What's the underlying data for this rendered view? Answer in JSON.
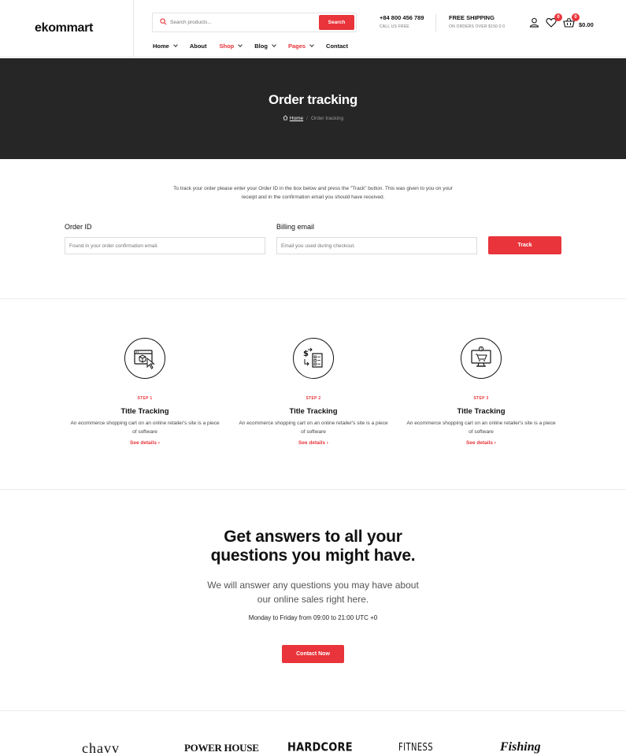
{
  "header": {
    "logo": "ekommart",
    "search": {
      "placeholder": "Search products...",
      "button": "Search"
    },
    "phone": "+84 800 456 789",
    "phone_sub": "CALL US FREE",
    "shipping": "FREE SHIPPING",
    "shipping_sub": "ON ORDERS OVER $150.0 0",
    "wishlist_count": "0",
    "cart_count": "0",
    "cart_total": "$0.00",
    "nav": [
      {
        "label": "Home"
      },
      {
        "label": "About"
      },
      {
        "label": "Shop"
      },
      {
        "label": "Blog"
      },
      {
        "label": "Pages"
      },
      {
        "label": "Contact"
      }
    ]
  },
  "banner": {
    "title": "Order tracking",
    "breadcrumb": {
      "home": "Home",
      "current": "Order tracking"
    }
  },
  "tracking": {
    "intro": "To track your order please enter your Order ID in the box below and press the \"Track\" button. This was given to you on your receipt and in the confirmation email you should have received.",
    "order_label": "Order ID",
    "order_placeholder": "Found in your order confirmation email.",
    "email_label": "Billing email",
    "email_placeholder": "Email you used during checkout.",
    "button": "Track"
  },
  "steps": [
    {
      "icon": "browser-box-cursor-icon",
      "num": "STEP 1",
      "title": "Title Tracking",
      "desc": "An ecommerce shopping cart on an online retailer's site is a piece of software",
      "link": "See details ›"
    },
    {
      "icon": "dollar-exchange-checklist-icon",
      "num": "STEP 2",
      "title": "Title Tracking",
      "desc": "An ecommerce shopping cart on an online retailer's site is a piece of software",
      "link": "See details ›"
    },
    {
      "icon": "monitor-cart-icon",
      "num": "STEP 3",
      "title": "Title Tracking",
      "desc": "An ecommerce shopping cart on an online retailer's site is a piece of software",
      "link": "See details ›"
    }
  ],
  "faq": {
    "title_line1": "Get answers to all your",
    "title_line2": "questions you might have.",
    "sub_line1": "We will answer any questions you may have about",
    "sub_line2": "our online sales right here.",
    "hours": "Monday to Friday from 09:00 to 21:00 UTC +0",
    "button": "Contact Now"
  },
  "brands": [
    "chavv",
    "POWER HOUSE",
    "HARDCORE",
    "FITNESS",
    "Fishing"
  ],
  "colors": {
    "accent": "#e8343a",
    "banner": "#262626"
  }
}
